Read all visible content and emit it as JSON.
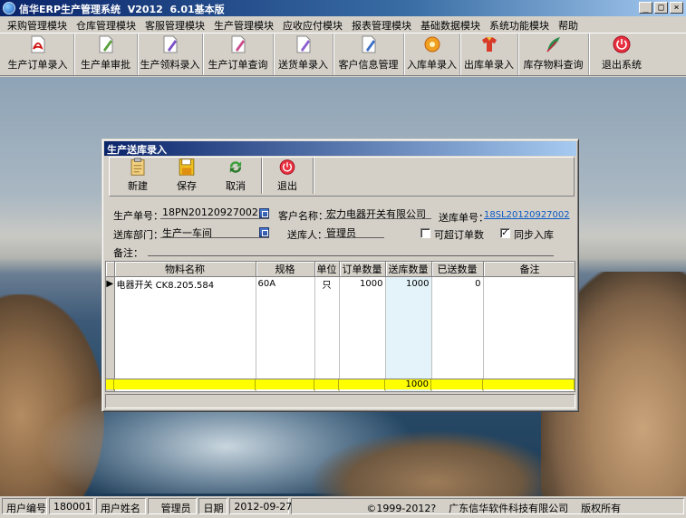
{
  "window": {
    "title": "信华ERP生产管理系统  V2012  6.01基本版"
  },
  "menu": [
    "采购管理模块",
    "仓库管理模块",
    "客服管理模块",
    "生产管理模块",
    "应收应付模块",
    "报表管理模块",
    "基础数据模块",
    "系统功能模块",
    "帮助"
  ],
  "toolbar": [
    {
      "label": "生产订单录入",
      "icon": "document-icon"
    },
    {
      "label": "生产单审批",
      "icon": "document-icon"
    },
    {
      "label": "生产领料录入",
      "icon": "document-icon"
    },
    {
      "label": "生产订单查询",
      "icon": "document-icon"
    },
    {
      "label": "送货单录入",
      "icon": "document-icon"
    },
    {
      "label": "客户信息管理",
      "icon": "document-icon"
    },
    {
      "label": "入库单录入",
      "icon": "gear-icon"
    },
    {
      "label": "出库单录入",
      "icon": "shirt-icon"
    },
    {
      "label": "库存物料查询",
      "icon": "feather-icon"
    },
    {
      "label": "退出系统",
      "icon": "power-icon"
    }
  ],
  "dialog": {
    "title": "生产送库录入",
    "buttons": {
      "new": "新建",
      "save": "保存",
      "cancel": "取消",
      "exit": "退出"
    },
    "form": {
      "prod_no_label": "生产单号：",
      "prod_no": "18PN20120927002",
      "customer_label": "客户名称：",
      "customer": "宏力电器开关有限公司",
      "delivery_no_label": "送库单号：",
      "delivery_no": "18SL20120927002",
      "dept_label": "送库部门：",
      "dept": "生产一车间",
      "person_label": "送库人：",
      "person": "管理员",
      "over_order_label": "可超订单数",
      "over_order_checked": false,
      "sync_label": "同步入库",
      "sync_checked": true,
      "remark_label": "备注："
    },
    "grid": {
      "columns": [
        "物料名称",
        "规格",
        "单位",
        "订单数量",
        "送库数量",
        "已送数量",
        "备注"
      ],
      "rows": [
        {
          "name": "电器开关 CK8.205.584",
          "spec": "60A",
          "unit": "只",
          "order_qty": "1000",
          "send_qty": "1000",
          "sent_qty": "0",
          "remark": ""
        }
      ],
      "total_send": "1000"
    }
  },
  "status": {
    "user_id_label": "用户编号",
    "user_id": "180001",
    "user_name_label": "用户姓名",
    "user_name": "管理员",
    "date_label": "日期",
    "date": "2012-09-27",
    "copyright": "©1999-2012?    广东信华软件科技有限公司    版权所有"
  }
}
